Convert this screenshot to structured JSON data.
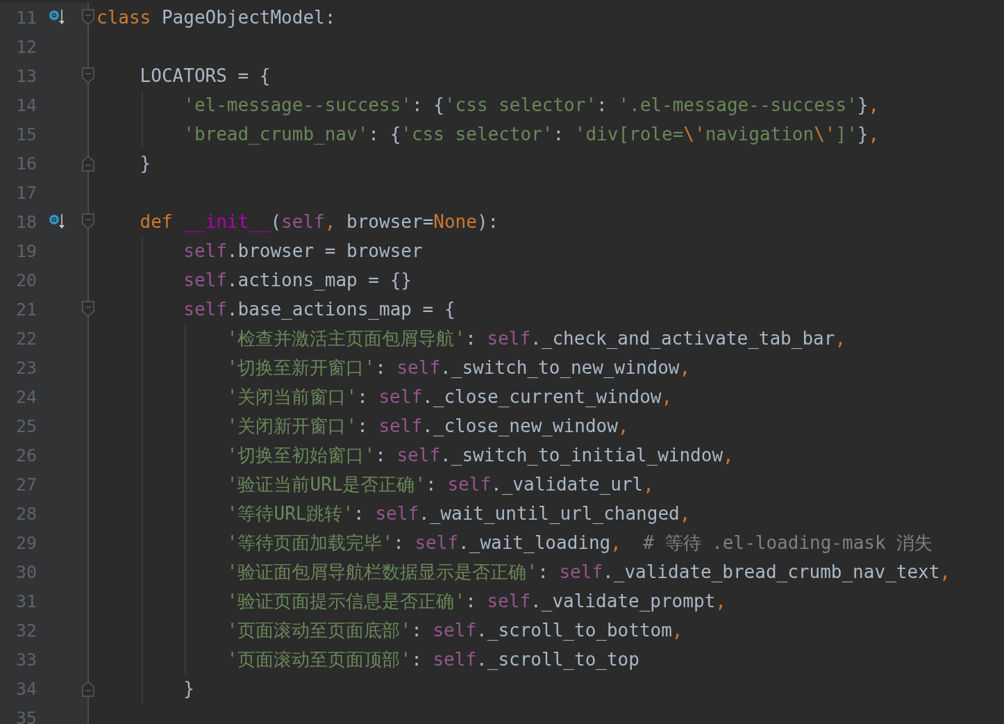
{
  "editor": {
    "lines": [
      {
        "number": "11",
        "gutter_icon": true,
        "fold_start": true,
        "fold_end": false,
        "tokens": [
          {
            "kind": "keyword",
            "text": "class"
          },
          {
            "kind": "plain",
            "text": " PageObjectModel:"
          }
        ]
      },
      {
        "number": "12",
        "gutter_icon": false,
        "fold_start": false,
        "fold_end": false
      },
      {
        "number": "13",
        "gutter_icon": false,
        "fold_start": true,
        "fold_end": false,
        "tokens": [
          {
            "kind": "plain",
            "text": "    LOCATORS = {"
          }
        ]
      },
      {
        "number": "14",
        "gutter_icon": false,
        "fold_start": false,
        "fold_end": false,
        "tokens": [
          {
            "kind": "string",
            "text": "        'el-message--success'"
          },
          {
            "kind": "plain",
            "text": ": {"
          },
          {
            "kind": "string",
            "text": "'css selector'"
          },
          {
            "kind": "plain",
            "text": ": "
          },
          {
            "kind": "string",
            "text": "'.el-message--success'"
          },
          {
            "kind": "plain",
            "text": "}"
          },
          {
            "kind": "keyword",
            "text": ","
          }
        ]
      },
      {
        "number": "15",
        "gutter_icon": false,
        "fold_start": false,
        "fold_end": false,
        "tokens": [
          {
            "kind": "string",
            "text": "        'bread_crumb_nav'"
          },
          {
            "kind": "plain",
            "text": ": {"
          },
          {
            "kind": "string",
            "text": "'css selector'"
          },
          {
            "kind": "plain",
            "text": ": "
          },
          {
            "kind": "string",
            "text": "'div[role="
          },
          {
            "kind": "keyword",
            "text": "\\'"
          },
          {
            "kind": "string",
            "text": "navigation"
          },
          {
            "kind": "keyword",
            "text": "\\'"
          },
          {
            "kind": "string",
            "text": "]'"
          },
          {
            "kind": "plain",
            "text": "}"
          },
          {
            "kind": "keyword",
            "text": ","
          }
        ]
      },
      {
        "number": "16",
        "gutter_icon": false,
        "fold_start": false,
        "fold_end": true,
        "tokens": [
          {
            "kind": "plain",
            "text": "    }"
          }
        ]
      },
      {
        "number": "17",
        "gutter_icon": false,
        "fold_start": false,
        "fold_end": false
      },
      {
        "number": "18",
        "gutter_icon": true,
        "fold_start": true,
        "fold_end": false,
        "tokens": [
          {
            "kind": "keyword",
            "text": "    def "
          },
          {
            "kind": "special",
            "text": "__init__"
          },
          {
            "kind": "plain",
            "text": "("
          },
          {
            "kind": "self",
            "text": "self"
          },
          {
            "kind": "keyword",
            "text": ", "
          },
          {
            "kind": "plain",
            "text": "browser="
          },
          {
            "kind": "keyword",
            "text": "None"
          },
          {
            "kind": "plain",
            "text": "):"
          }
        ]
      },
      {
        "number": "19",
        "gutter_icon": false,
        "fold_start": false,
        "fold_end": false,
        "tokens": [
          {
            "kind": "self",
            "text": "        self"
          },
          {
            "kind": "plain",
            "text": ".browser = browser"
          }
        ]
      },
      {
        "number": "20",
        "gutter_icon": false,
        "fold_start": false,
        "fold_end": false,
        "tokens": [
          {
            "kind": "self",
            "text": "        self"
          },
          {
            "kind": "plain",
            "text": ".actions_map = {}"
          }
        ]
      },
      {
        "number": "21",
        "gutter_icon": false,
        "fold_start": true,
        "fold_end": false,
        "tokens": [
          {
            "kind": "self",
            "text": "        self"
          },
          {
            "kind": "plain",
            "text": ".base_actions_map = {"
          }
        ]
      },
      {
        "number": "22",
        "gutter_icon": false,
        "fold_start": false,
        "fold_end": false,
        "tokens": [
          {
            "kind": "string",
            "text": "            '检查并激活主页面包屑导航'"
          },
          {
            "kind": "plain",
            "text": ": "
          },
          {
            "kind": "self",
            "text": "self"
          },
          {
            "kind": "plain",
            "text": "._check_and_activate_tab_bar"
          },
          {
            "kind": "keyword",
            "text": ","
          }
        ]
      },
      {
        "number": "23",
        "gutter_icon": false,
        "fold_start": false,
        "fold_end": false,
        "tokens": [
          {
            "kind": "string",
            "text": "            '切换至新开窗口'"
          },
          {
            "kind": "plain",
            "text": ": "
          },
          {
            "kind": "self",
            "text": "self"
          },
          {
            "kind": "plain",
            "text": "._switch_to_new_window"
          },
          {
            "kind": "keyword",
            "text": ","
          }
        ]
      },
      {
        "number": "24",
        "gutter_icon": false,
        "fold_start": false,
        "fold_end": false,
        "tokens": [
          {
            "kind": "string",
            "text": "            '关闭当前窗口'"
          },
          {
            "kind": "plain",
            "text": ": "
          },
          {
            "kind": "self",
            "text": "self"
          },
          {
            "kind": "plain",
            "text": "._close_current_window"
          },
          {
            "kind": "keyword",
            "text": ","
          }
        ]
      },
      {
        "number": "25",
        "gutter_icon": false,
        "fold_start": false,
        "fold_end": false,
        "tokens": [
          {
            "kind": "string",
            "text": "            '关闭新开窗口'"
          },
          {
            "kind": "plain",
            "text": ": "
          },
          {
            "kind": "self",
            "text": "self"
          },
          {
            "kind": "plain",
            "text": "._close_new_window"
          },
          {
            "kind": "keyword",
            "text": ","
          }
        ]
      },
      {
        "number": "26",
        "gutter_icon": false,
        "fold_start": false,
        "fold_end": false,
        "tokens": [
          {
            "kind": "string",
            "text": "            '切换至初始窗口'"
          },
          {
            "kind": "plain",
            "text": ": "
          },
          {
            "kind": "self",
            "text": "self"
          },
          {
            "kind": "plain",
            "text": "._switch_to_initial_window"
          },
          {
            "kind": "keyword",
            "text": ","
          }
        ]
      },
      {
        "number": "27",
        "gutter_icon": false,
        "fold_start": false,
        "fold_end": false,
        "tokens": [
          {
            "kind": "string",
            "text": "            '验证当前URL是否正确'"
          },
          {
            "kind": "plain",
            "text": ": "
          },
          {
            "kind": "self",
            "text": "self"
          },
          {
            "kind": "plain",
            "text": "._validate_url"
          },
          {
            "kind": "keyword",
            "text": ","
          }
        ]
      },
      {
        "number": "28",
        "gutter_icon": false,
        "fold_start": false,
        "fold_end": false,
        "tokens": [
          {
            "kind": "string",
            "text": "            '等待URL跳转'"
          },
          {
            "kind": "plain",
            "text": ": "
          },
          {
            "kind": "self",
            "text": "self"
          },
          {
            "kind": "plain",
            "text": "._wait_until_url_changed"
          },
          {
            "kind": "keyword",
            "text": ","
          }
        ]
      },
      {
        "number": "29",
        "gutter_icon": false,
        "fold_start": false,
        "fold_end": false,
        "tokens": [
          {
            "kind": "string",
            "text": "            '等待页面加载完毕'"
          },
          {
            "kind": "plain",
            "text": ": "
          },
          {
            "kind": "self",
            "text": "self"
          },
          {
            "kind": "plain",
            "text": "._wait_loading"
          },
          {
            "kind": "keyword",
            "text": ","
          },
          {
            "kind": "comment",
            "text": "  # 等待 .el-loading-mask 消失"
          }
        ]
      },
      {
        "number": "30",
        "gutter_icon": false,
        "fold_start": false,
        "fold_end": false,
        "tokens": [
          {
            "kind": "string",
            "text": "            '验证面包屑导航栏数据显示是否正确'"
          },
          {
            "kind": "plain",
            "text": ": "
          },
          {
            "kind": "self",
            "text": "self"
          },
          {
            "kind": "plain",
            "text": "._validate_bread_crumb_nav_text"
          },
          {
            "kind": "keyword",
            "text": ","
          }
        ]
      },
      {
        "number": "31",
        "gutter_icon": false,
        "fold_start": false,
        "fold_end": false,
        "tokens": [
          {
            "kind": "string",
            "text": "            '验证页面提示信息是否正确'"
          },
          {
            "kind": "plain",
            "text": ": "
          },
          {
            "kind": "self",
            "text": "self"
          },
          {
            "kind": "plain",
            "text": "._validate_prompt"
          },
          {
            "kind": "keyword",
            "text": ","
          }
        ]
      },
      {
        "number": "32",
        "gutter_icon": false,
        "fold_start": false,
        "fold_end": false,
        "tokens": [
          {
            "kind": "string",
            "text": "            '页面滚动至页面底部'"
          },
          {
            "kind": "plain",
            "text": ": "
          },
          {
            "kind": "self",
            "text": "self"
          },
          {
            "kind": "plain",
            "text": "._scroll_to_bottom"
          },
          {
            "kind": "keyword",
            "text": ","
          }
        ]
      },
      {
        "number": "33",
        "gutter_icon": false,
        "fold_start": false,
        "fold_end": false,
        "tokens": [
          {
            "kind": "string",
            "text": "            '页面滚动至页面顶部'"
          },
          {
            "kind": "plain",
            "text": ": "
          },
          {
            "kind": "self",
            "text": "self"
          },
          {
            "kind": "plain",
            "text": "._scroll_to_top"
          }
        ]
      },
      {
        "number": "34",
        "gutter_icon": false,
        "fold_start": false,
        "fold_end": true,
        "tokens": [
          {
            "kind": "plain",
            "text": "        }"
          }
        ]
      },
      {
        "number": "35",
        "gutter_icon": false,
        "fold_start": false,
        "fold_end": false
      }
    ]
  }
}
